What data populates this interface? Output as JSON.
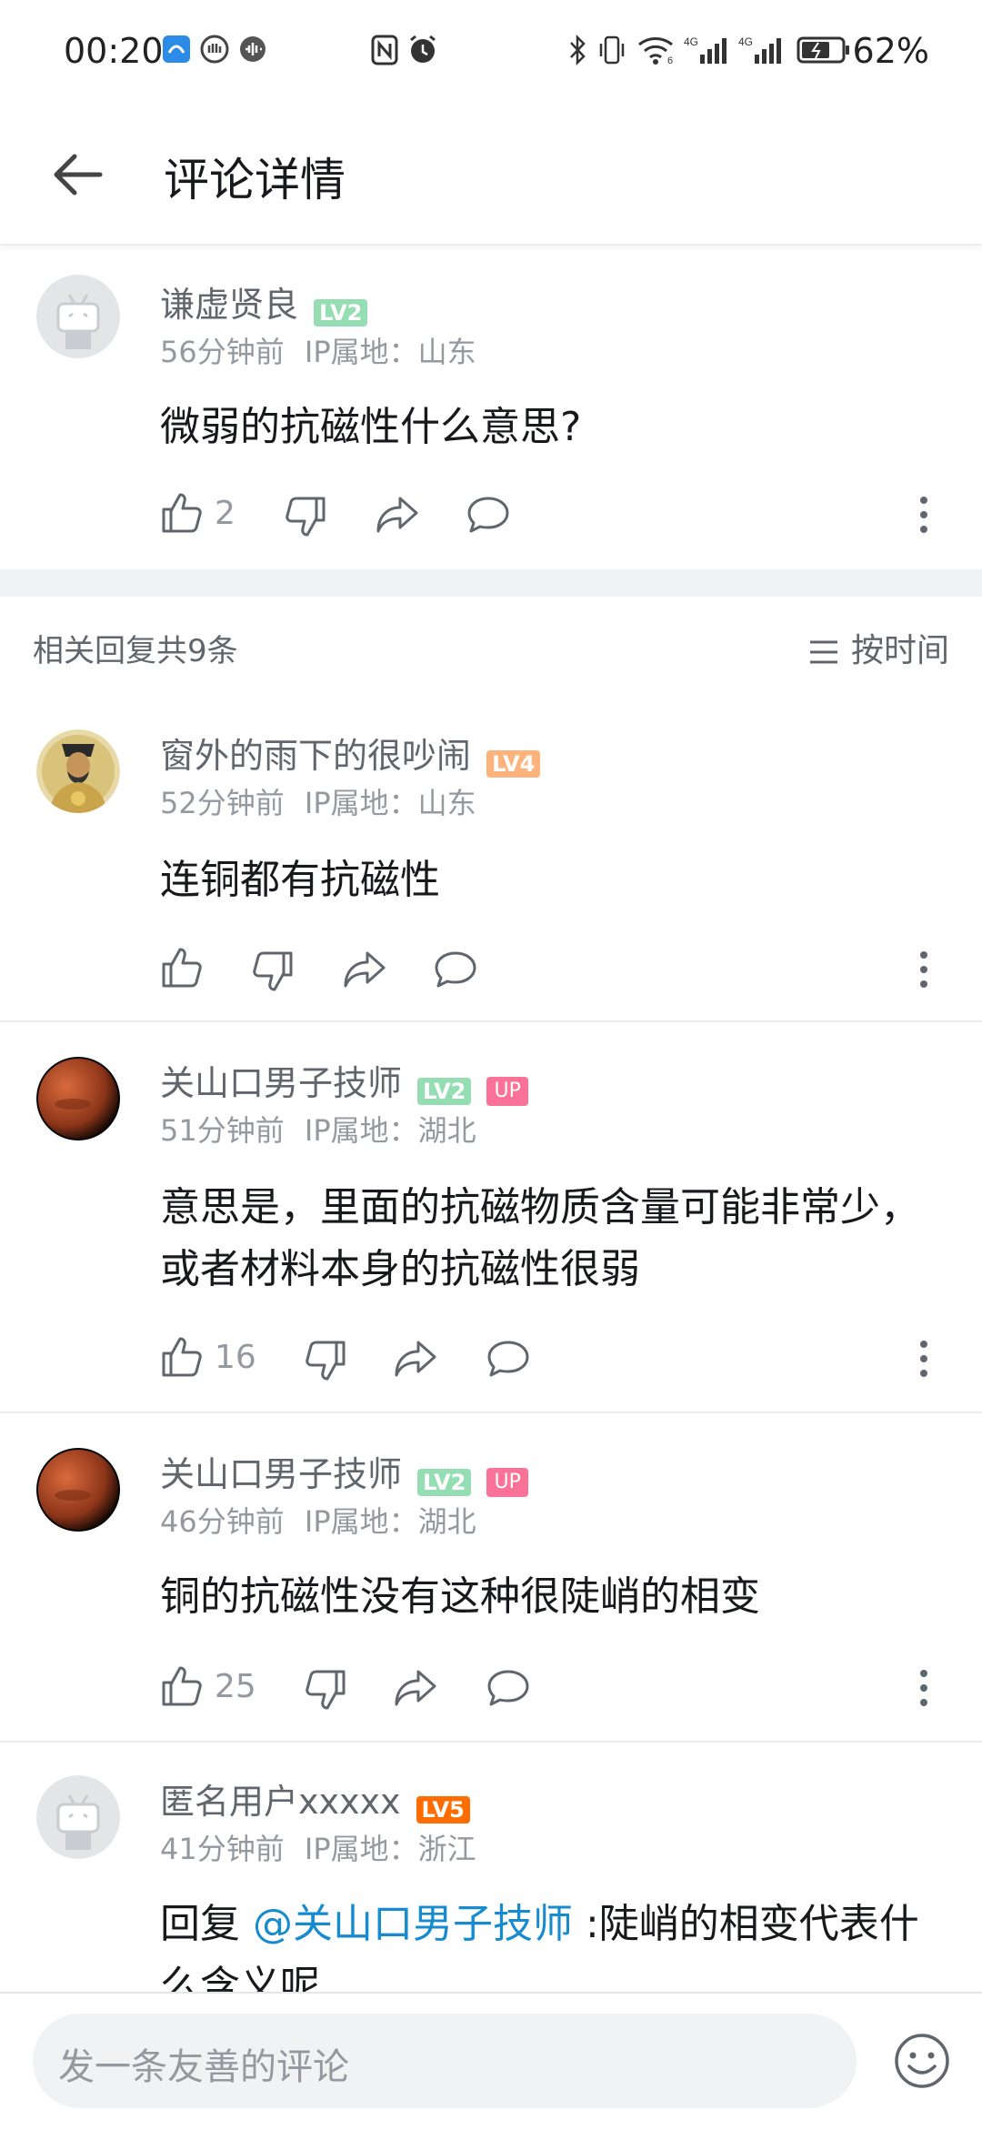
{
  "status_bar": {
    "time": "00:20",
    "battery": "62%"
  },
  "header": {
    "title": "评论详情"
  },
  "root_comment": {
    "username": "谦虚贤良",
    "level": "LV2",
    "time": "56分钟前",
    "ip": "IP属地：山东",
    "text": "微弱的抗磁性什么意思?",
    "likes": "2"
  },
  "replies_header": {
    "count_label": "相关回复共9条",
    "sort_label": "按时间"
  },
  "replies": [
    {
      "username": "窗外的雨下的很吵闹",
      "level": "LV4",
      "time": "52分钟前",
      "ip": "IP属地：山东",
      "text": "连铜都有抗磁性",
      "likes": ""
    },
    {
      "username": "关山口男子技师",
      "level": "LV2",
      "up": "UP",
      "time": "51分钟前",
      "ip": "IP属地：湖北",
      "text_line1": "意思是，里面的抗磁物质含量可能非常少，",
      "text_line2": "或者材料本身的抗磁性很弱",
      "likes": "16"
    },
    {
      "username": "关山口男子技师",
      "level": "LV2",
      "up": "UP",
      "time": "46分钟前",
      "ip": "IP属地：湖北",
      "text": "铜的抗磁性没有这种很陡峭的相变",
      "likes": "25"
    },
    {
      "username": "匿名用户xxxxx",
      "level": "LV5",
      "time": "41分钟前",
      "ip": "IP属地：浙江",
      "reply_prefix": "回复 ",
      "mention": "@关山口男子技师",
      "text_rest": " :陡峭的相变代表什",
      "text_line2": "么含义呢"
    }
  ],
  "composer": {
    "placeholder": "发一条友善的评论"
  },
  "colors": {
    "lv2": "#95ddb2",
    "lv4": "#ffb37c",
    "lv5": "#ff6c00",
    "up": "#fb7299",
    "mention": "#178bcf"
  }
}
